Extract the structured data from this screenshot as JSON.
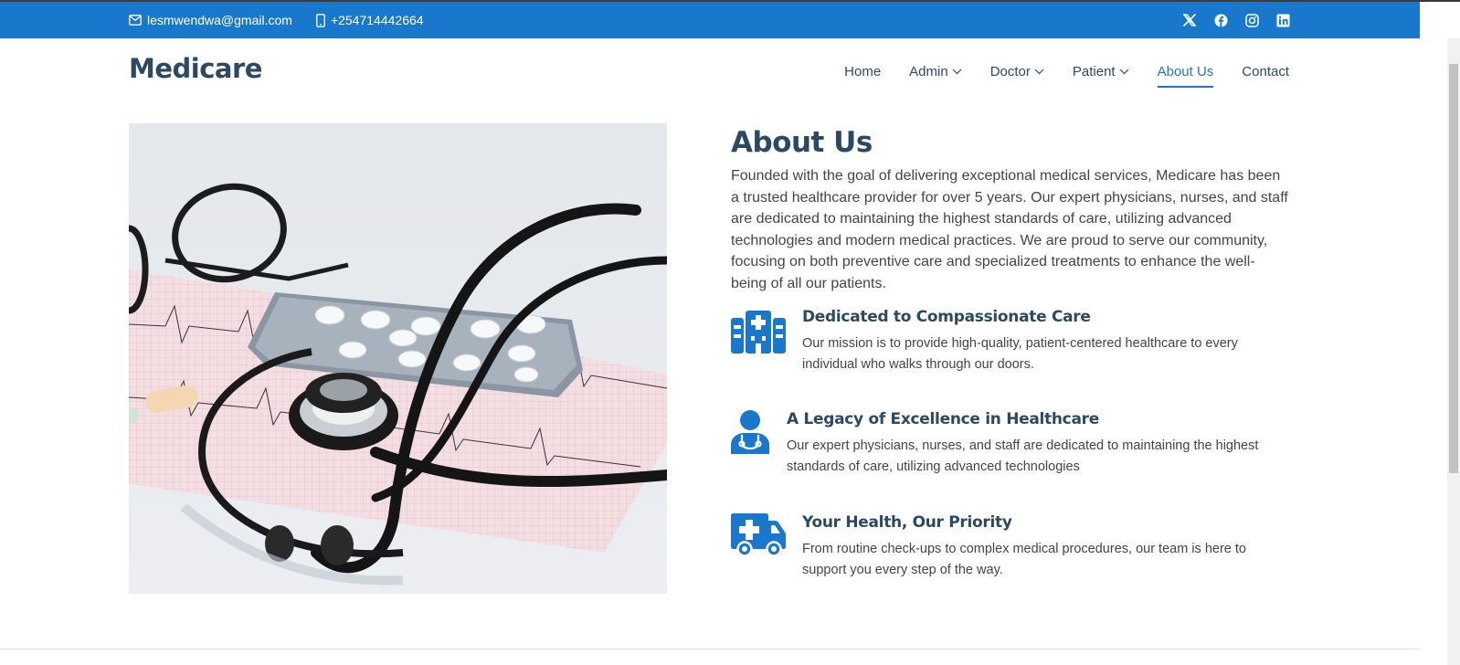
{
  "topbar": {
    "email": "lesmwendwa@gmail.com",
    "phone": "+254714442664",
    "social_icons": [
      "x-twitter-icon",
      "facebook-icon",
      "instagram-icon",
      "linkedin-icon"
    ]
  },
  "header": {
    "logo": "Medicare",
    "nav": [
      {
        "label": "Home",
        "dropdown": false
      },
      {
        "label": "Admin",
        "dropdown": true
      },
      {
        "label": "Doctor",
        "dropdown": true
      },
      {
        "label": "Patient",
        "dropdown": true
      },
      {
        "label": "About Us",
        "dropdown": false,
        "active": true
      },
      {
        "label": "Contact",
        "dropdown": false
      }
    ]
  },
  "about": {
    "title": "About Us",
    "description": "Founded with the goal of delivering exceptional medical services, Medicare has been a trusted healthcare provider for over 5 years. Our expert physicians, nurses, and staff are dedicated to maintaining the highest standards of care, utilizing advanced technologies and modern medical practices. We are proud to serve our community, focusing on both preventive care and specialized treatments to enhance the well-being of all our patients.",
    "features": [
      {
        "icon": "hospital-icon",
        "title": "Dedicated to Compassionate Care",
        "text": "Our mission is to provide high-quality, patient-centered healthcare to every individual who walks through our doors."
      },
      {
        "icon": "doctor-icon",
        "title": "A Legacy of Excellence in Healthcare",
        "text": "Our expert physicians, nurses, and staff are dedicated to maintaining the highest standards of care, utilizing advanced technologies"
      },
      {
        "icon": "ambulance-icon",
        "title": "Your Health, Our Priority",
        "text": "From routine check-ups to complex medical procedures, our team is here to support you every step of the way."
      }
    ]
  },
  "colors": {
    "accent": "#1977cc",
    "heading": "#2c4964",
    "text": "#444444"
  }
}
